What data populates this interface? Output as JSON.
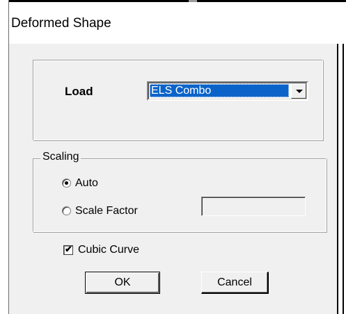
{
  "window": {
    "title": "Deformed Shape"
  },
  "load": {
    "label": "Load",
    "selected": "ELS Combo"
  },
  "scaling": {
    "caption": "Scaling",
    "options": [
      {
        "label": "Auto",
        "checked": true
      },
      {
        "label": "Scale Factor",
        "checked": false
      }
    ],
    "scale_factor_value": ""
  },
  "cubic_curve": {
    "label": "Cubic Curve",
    "checked": true
  },
  "buttons": {
    "ok": "OK",
    "cancel": "Cancel"
  },
  "icons": {
    "dropdown": "chevron-down-icon",
    "check": "check-icon"
  }
}
